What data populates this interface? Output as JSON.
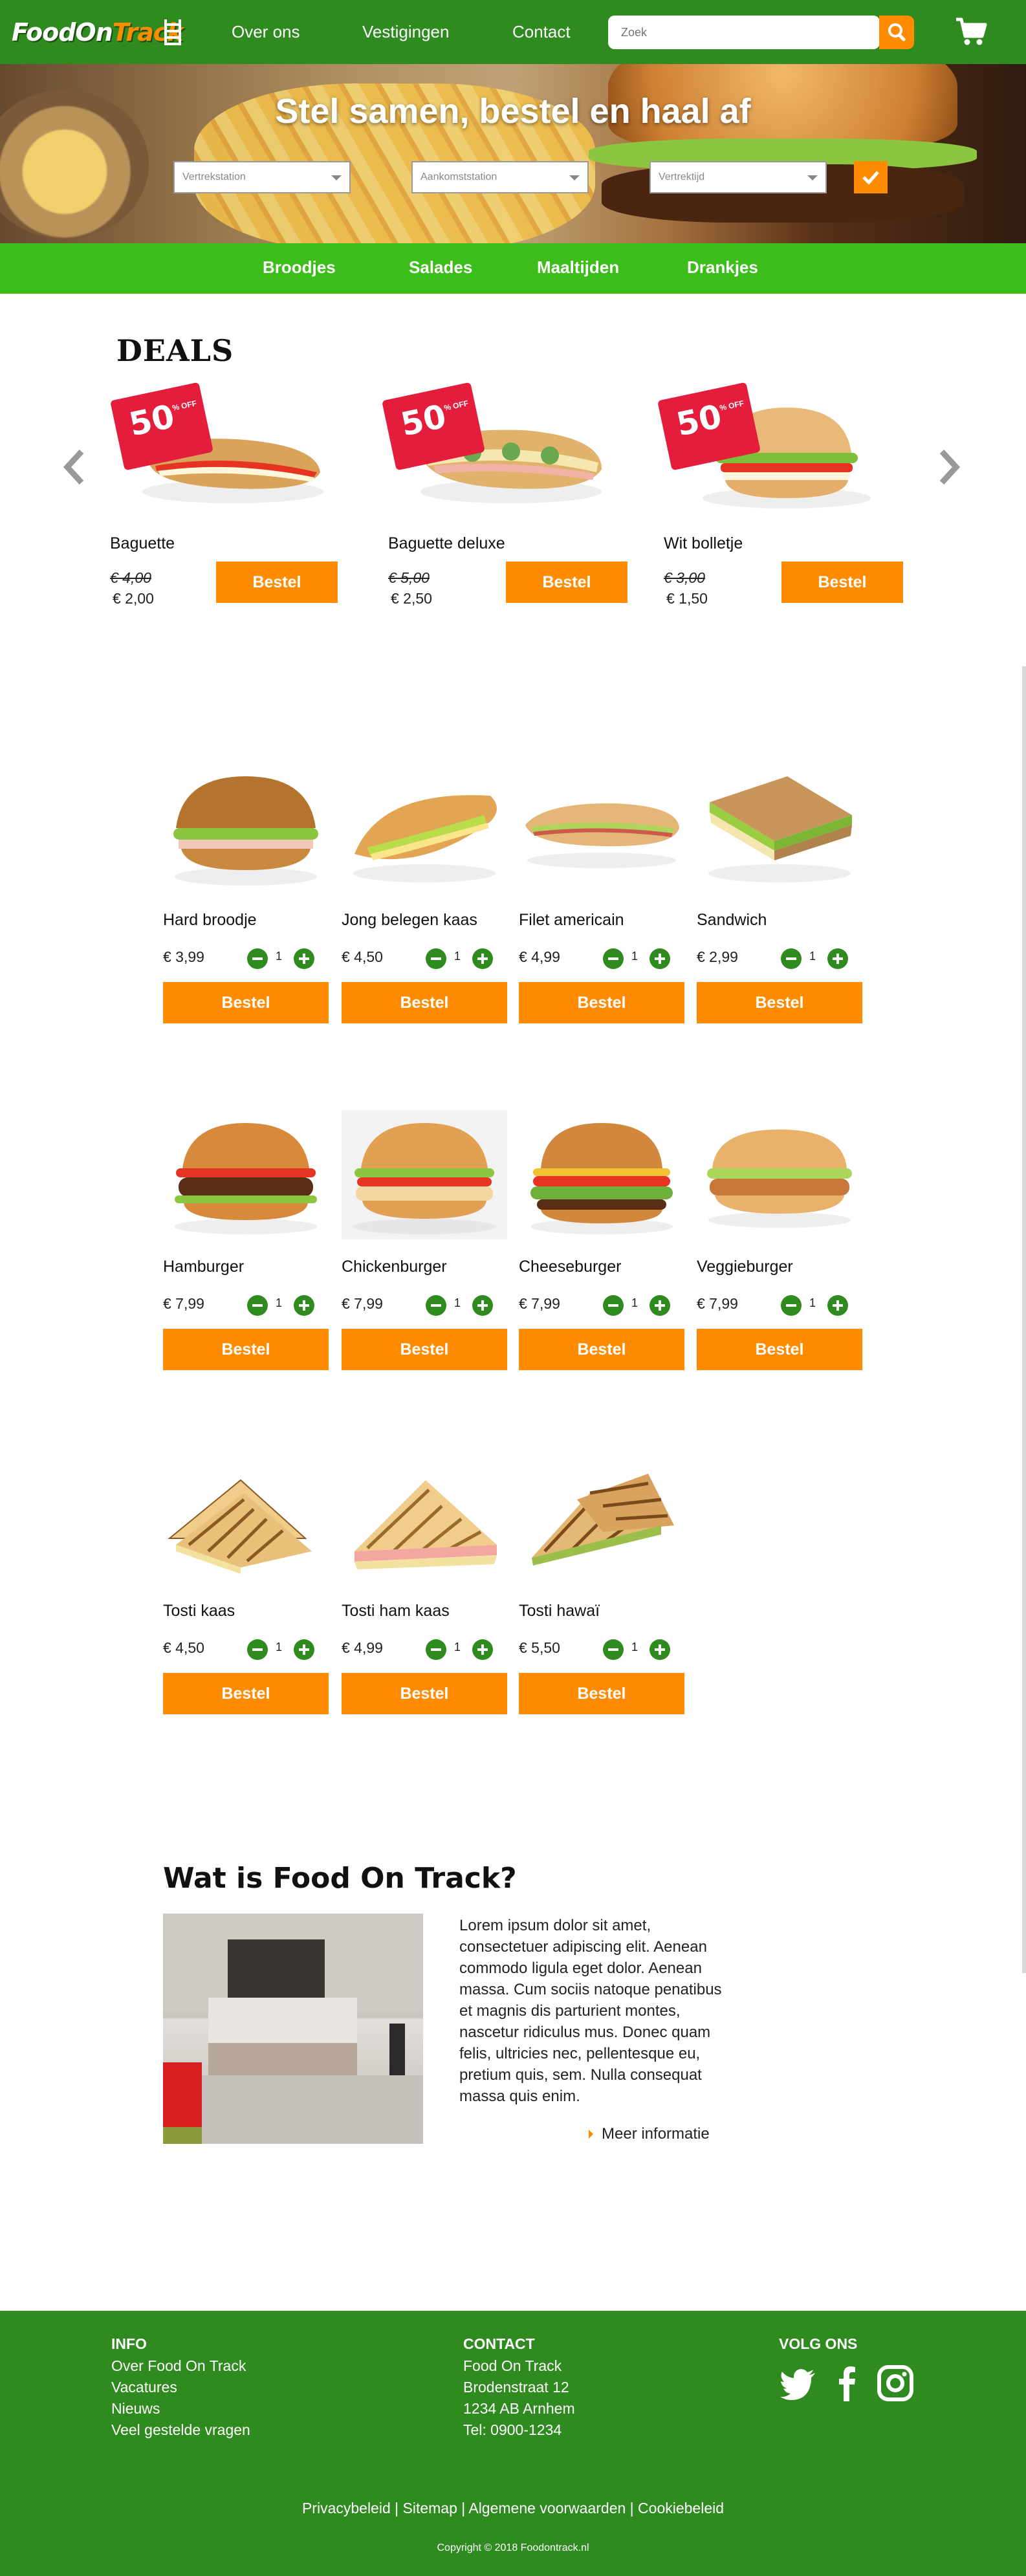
{
  "header": {
    "logo_food": "FoodOn",
    "logo_track": "Track",
    "nav": [
      "Over ons",
      "Vestigingen",
      "Contact"
    ],
    "search_placeholder": "Zoek"
  },
  "hero": {
    "title": "Stel samen, bestel en haal af",
    "departure_placeholder": "Vertrekstation",
    "arrival_placeholder": "Aankomststation",
    "time_placeholder": "Vertrektijd"
  },
  "categories": [
    "Broodjes",
    "Salades",
    "Maaltijden",
    "Drankjes"
  ],
  "deals": {
    "title": "DEALS",
    "badge": "50",
    "badge_off": "% OFF",
    "items": [
      {
        "name": "Baguette",
        "old_price": "€ 4,00",
        "new_price": "€ 2,00",
        "button": "Bestel"
      },
      {
        "name": "Baguette deluxe",
        "old_price": "€ 5,00",
        "new_price": "€ 2,50",
        "button": "Bestel"
      },
      {
        "name": "Wit bolletje",
        "old_price": "€ 3,00",
        "new_price": "€ 1,50",
        "button": "Bestel"
      }
    ]
  },
  "products": [
    {
      "name": "Hard broodje",
      "price": "€ 3,99",
      "qty": "1",
      "button": "Bestel"
    },
    {
      "name": "Jong belegen kaas",
      "price": "€ 4,50",
      "qty": "1",
      "button": "Bestel"
    },
    {
      "name": "Filet americain",
      "price": "€ 4,99",
      "qty": "1",
      "button": "Bestel"
    },
    {
      "name": "Sandwich",
      "price": "€ 2,99",
      "qty": "1",
      "button": "Bestel"
    },
    {
      "name": "Hamburger",
      "price": "€ 7,99",
      "qty": "1",
      "button": "Bestel"
    },
    {
      "name": "Chickenburger",
      "price": "€ 7,99",
      "qty": "1",
      "button": "Bestel"
    },
    {
      "name": "Cheeseburger",
      "price": "€ 7,99",
      "qty": "1",
      "button": "Bestel"
    },
    {
      "name": "Veggieburger",
      "price": "€ 7,99",
      "qty": "1",
      "button": "Bestel"
    },
    {
      "name": "Tosti kaas",
      "price": "€ 4,50",
      "qty": "1",
      "button": "Bestel"
    },
    {
      "name": "Tosti ham kaas",
      "price": "€ 4,99",
      "qty": "1",
      "button": "Bestel"
    },
    {
      "name": "Tosti hawaï",
      "price": "€ 5,50",
      "qty": "1",
      "button": "Bestel"
    }
  ],
  "about": {
    "title": "Wat is Food On Track?",
    "text": "Lorem ipsum dolor sit amet, consectetuer adipiscing elit. Aenean commodo ligula eget dolor. Aenean massa. Cum sociis natoque penatibus et magnis dis parturient montes, nascetur ridiculus mus. Donec quam felis, ultricies nec, pellentesque eu, pretium quis, sem. Nulla consequat massa quis enim.",
    "more": "Meer informatie"
  },
  "footer": {
    "info_title": "INFO",
    "info_links": [
      "Over Food On Track",
      "Vacatures",
      "Nieuws",
      "Veel gestelde vragen"
    ],
    "contact_title": "CONTACT",
    "contact_lines": [
      "Food On Track",
      "Brodenstraat 12",
      "1234 AB Arnhem",
      "Tel: 0900-1234"
    ],
    "social_title": "VOLG ONS",
    "bottom_links": "Privacybeleid | Sitemap | Algemene voorwaarden | Cookiebeleid",
    "copyright": "Copyright © 2018 Foodontrack.nl"
  },
  "colors": {
    "brand_green": "#2f8a1f",
    "bright_green": "#3dbd1a",
    "accent_orange": "#ff8c00",
    "badge_red": "#e31d3b"
  }
}
